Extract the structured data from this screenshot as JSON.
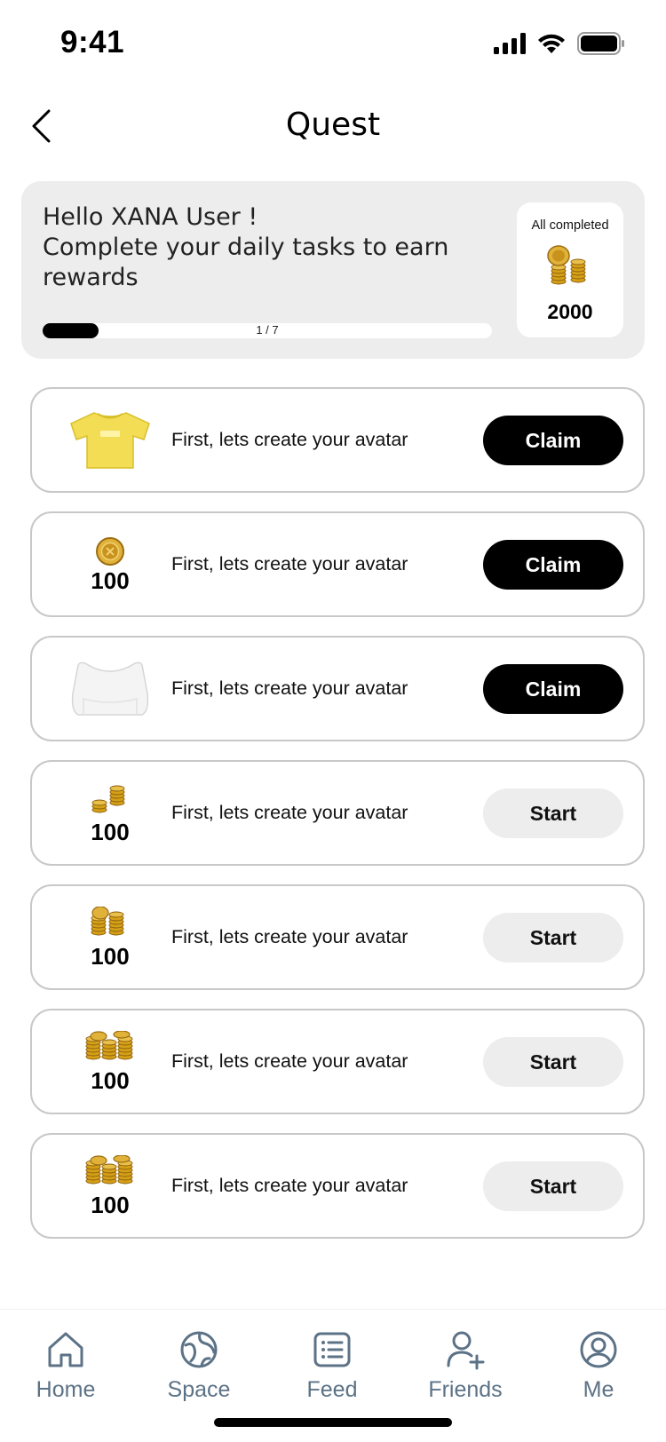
{
  "status_bar": {
    "time": "9:41",
    "signal_icon": "cellular-signal-icon",
    "wifi_icon": "wifi-icon",
    "battery_icon": "battery-icon"
  },
  "header": {
    "title": "Quest",
    "back_icon": "chevron-left-icon"
  },
  "summary": {
    "greeting_line1": "Hello XANA User !",
    "greeting_line2": "Complete your daily tasks to earn rewards",
    "progress_label": "1 / 7",
    "progress_fraction": 0.125,
    "reward_caption": "All completed",
    "reward_amount": "2000",
    "reward_icon": "gold-coin-stack-icon"
  },
  "quests": [
    {
      "reward_icon": "yellow-tshirt-icon",
      "amount": "",
      "text": "First, lets create your avatar",
      "button": "Claim",
      "state": "claim"
    },
    {
      "reward_icon": "single-coin-icon",
      "amount": "100",
      "text": "First, lets create your avatar",
      "button": "Claim",
      "state": "claim"
    },
    {
      "reward_icon": "white-crop-top-icon",
      "amount": "",
      "text": "First, lets create your avatar",
      "button": "Claim",
      "state": "claim"
    },
    {
      "reward_icon": "small-coin-stack-icon",
      "amount": "100",
      "text": "First, lets create your avatar",
      "button": "Start",
      "state": "start"
    },
    {
      "reward_icon": "coin-stack-icon",
      "amount": "100",
      "text": "First, lets create your avatar",
      "button": "Start",
      "state": "start"
    },
    {
      "reward_icon": "large-coin-stack-icon",
      "amount": "100",
      "text": "First, lets create your avatar",
      "button": "Start",
      "state": "start"
    },
    {
      "reward_icon": "large-coin-stack-icon",
      "amount": "100",
      "text": "First, lets create your avatar",
      "button": "Start",
      "state": "start"
    }
  ],
  "tabs": [
    {
      "label": "Home",
      "icon": "home-icon"
    },
    {
      "label": "Space",
      "icon": "globe-icon"
    },
    {
      "label": "Feed",
      "icon": "list-icon"
    },
    {
      "label": "Friends",
      "icon": "add-friend-icon"
    },
    {
      "label": "Me",
      "icon": "profile-icon"
    }
  ],
  "colors": {
    "accent": "#000000",
    "card_bg": "#ededed",
    "tab_color": "#5c7286",
    "border": "#c8c8c8",
    "coin_gold": "#d4a017"
  }
}
